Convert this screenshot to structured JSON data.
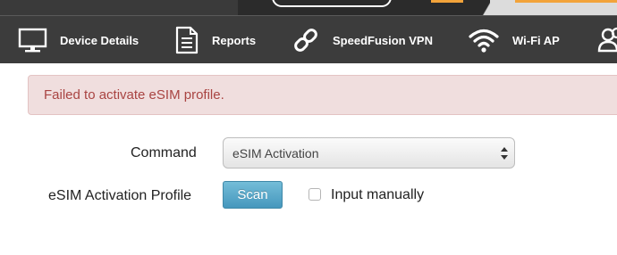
{
  "nav": {
    "items": [
      {
        "label": "Device Details",
        "icon": "monitor-icon"
      },
      {
        "label": "Reports",
        "icon": "document-icon"
      },
      {
        "label": "SpeedFusion VPN",
        "icon": "chain-link-icon"
      },
      {
        "label": "Wi-Fi AP",
        "icon": "wifi-icon"
      },
      {
        "label": "",
        "icon": "users-icon"
      }
    ]
  },
  "alert": {
    "message": "Failed to activate eSIM profile."
  },
  "form": {
    "command_label": "Command",
    "command_value": "eSIM Activation",
    "profile_label": "eSIM Activation Profile",
    "scan_label": "Scan",
    "input_manually_label": "Input manually",
    "input_manually_checked": false
  },
  "colors": {
    "nav_bg": "#3c3c3c",
    "alert_bg": "#f0dede",
    "alert_text": "#a94442",
    "scan_button": "#4597bd",
    "accent_orange": "#f2a33a"
  }
}
